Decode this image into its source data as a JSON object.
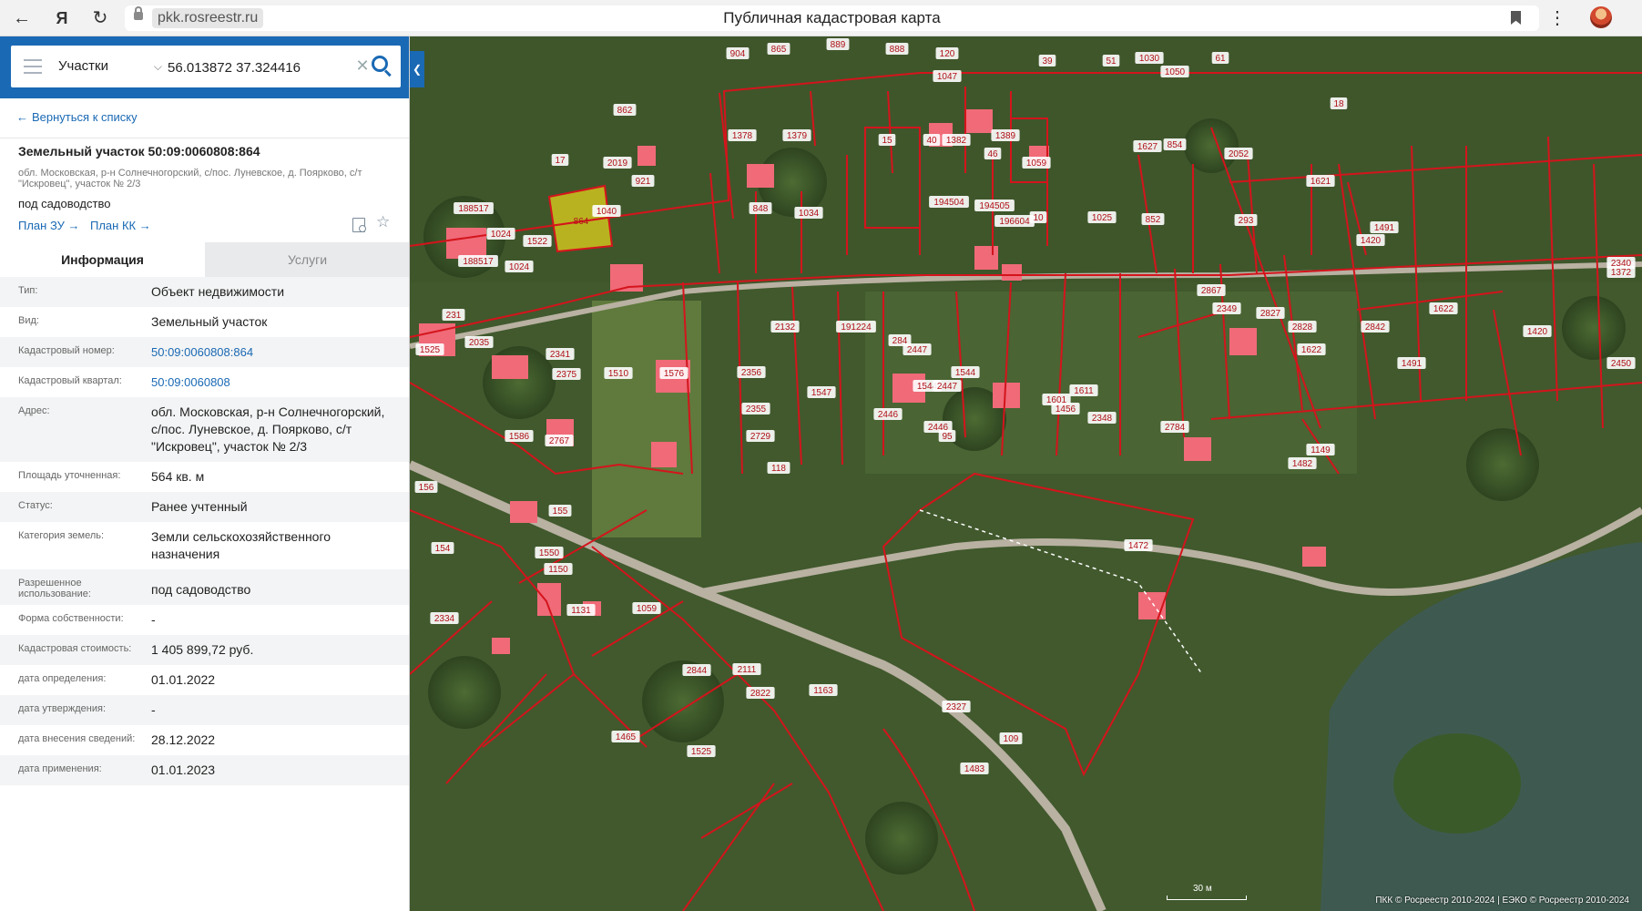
{
  "browser": {
    "url": "pkk.rosreestr.ru",
    "page_title": "Публичная кадастровая карта"
  },
  "search": {
    "layer": "Участки",
    "query": "56.013872 37.324416"
  },
  "panel": {
    "back_link": "Вернуться к списку",
    "title": "Земельный участок 50:09:0060808:864",
    "address_short": "обл. Московская, р-н Солнечногорский, с/пос. Луневское, д. Поярково, с/т \"Искровец\", участок № 2/3",
    "use": "под садоводство",
    "plan_zu": "План ЗУ",
    "plan_kk": "План КК",
    "tabs": {
      "info": "Информация",
      "services": "Услуги"
    },
    "rows": [
      {
        "label": "Тип:",
        "value": "Объект недвижимости"
      },
      {
        "label": "Вид:",
        "value": "Земельный участок"
      },
      {
        "label": "Кадастровый номер:",
        "value": "50:09:0060808:864"
      },
      {
        "label": "Кадастровый квартал:",
        "value": "50:09:0060808"
      },
      {
        "label": "Адрес:",
        "value": "обл. Московская, р-н Солнечногорский, с/пос. Луневское, д. Поярково, с/т \"Искровец\", участок № 2/3"
      },
      {
        "label": "Площадь уточненная:",
        "value": "564 кв. м"
      },
      {
        "label": "Статус:",
        "value": "Ранее учтенный"
      },
      {
        "label": "Категория земель:",
        "value": "Земли сельскохозяйственного назначения"
      },
      {
        "label": "Разрешенное использование:",
        "value": "под садоводство"
      },
      {
        "label": "Форма собственности:",
        "value": "-"
      },
      {
        "label": "Кадастровая стоимость:",
        "value": "1 405 899,72 руб."
      },
      {
        "label": "дата определения:",
        "value": "01.01.2022"
      },
      {
        "label": "дата утверждения:",
        "value": "-"
      },
      {
        "label": "дата внесения сведений:",
        "value": "28.12.2022"
      },
      {
        "label": "дата применения:",
        "value": "01.01.2023"
      }
    ]
  },
  "map": {
    "scale": "30 м",
    "copyright": "ПКК © Росреестр 2010-2024 | ЕЭКО © Росреестр 2010-2024",
    "selected_parcel": "864",
    "parcel_labels": [
      "904",
      "865",
      "889",
      "888",
      "120",
      "1047",
      "39",
      "51",
      "1030",
      "1050",
      "61",
      "18",
      "862",
      "1378",
      "1379",
      "15",
      "40",
      "1382",
      "1389",
      "46",
      "1059",
      "1627",
      "854",
      "2052",
      "1621",
      "17",
      "2019",
      "921",
      "188517",
      "1040",
      "848",
      "1034",
      "194504",
      "194505",
      "196604",
      "10",
      "1025",
      "852",
      "293",
      "1491",
      "1420",
      "1024",
      "1522",
      "188517",
      "1024",
      "231",
      "2035",
      "1525",
      "2341",
      "2375",
      "1510",
      "1576",
      "2356",
      "2132",
      "191224",
      "284",
      "2447",
      "1544",
      "2447",
      "1544",
      "2867",
      "2349",
      "2827",
      "2828",
      "2842",
      "1622",
      "1622",
      "1491",
      "1420",
      "2450",
      "1372",
      "2340",
      "1586",
      "2767",
      "2355",
      "2729",
      "118",
      "1547",
      "2446",
      "2446",
      "95",
      "1601",
      "1456",
      "1611",
      "2348",
      "2784",
      "1149",
      "1482",
      "156",
      "155",
      "154",
      "1550",
      "1150",
      "1131",
      "1059",
      "2334",
      "2844",
      "2111",
      "2822",
      "1163",
      "1465",
      "1525",
      "2327",
      "109",
      "1483",
      "1472"
    ],
    "colors": {
      "boundary": "#d4141c",
      "building": "#f06a78",
      "selected_fill": "#e3d21d",
      "water": "#3e5a50",
      "road": "#c8bfb2"
    }
  }
}
